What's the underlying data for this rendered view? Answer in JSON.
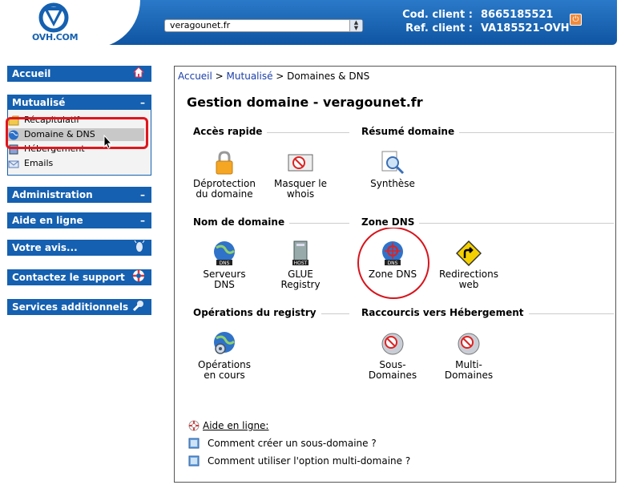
{
  "header": {
    "logo_text": "OVH.COM",
    "domain_select": "veragounet.fr",
    "client_code_label": "Cod. client :",
    "client_code": "8665185521",
    "client_ref_label": "Ref. client :",
    "client_ref": "VA185521-OVH",
    "brand_color": "#1560b0"
  },
  "sidebar": {
    "accueil": "Accueil",
    "mutualise": "Mutualisé",
    "mutualise_items": [
      "Récapitulatif",
      "Domaine & DNS",
      "Hébergement",
      "Emails"
    ],
    "administration": "Administration",
    "aide": "Aide en ligne",
    "avis": "Votre avis...",
    "support": "Contactez le support",
    "services": "Services additionnels",
    "collapse_symbol": "–"
  },
  "breadcrumb": {
    "home": "Accueil",
    "sep1": " > ",
    "mutualise": "Mutualisé",
    "sep2": " > ",
    "current": "Domaines & DNS"
  },
  "page_title": "Gestion domaine - veragounet.fr",
  "sections": {
    "acces_rapide": "Accès rapide",
    "resume": "Résumé domaine",
    "nom_domaine": "Nom de domaine",
    "zone_dns": "Zone DNS",
    "operations": "Opérations du registry",
    "raccourcis": "Raccourcis vers Hébergement"
  },
  "tiles": {
    "deprotection": [
      "Déprotection",
      "du domaine"
    ],
    "masquer": [
      "Masquer le",
      "whois"
    ],
    "synthese": [
      "Synthèse"
    ],
    "serveurs": [
      "Serveurs",
      "DNS"
    ],
    "glue": [
      "GLUE",
      "Registry"
    ],
    "zone": [
      "Zone DNS"
    ],
    "redirections": [
      "Redirections",
      "web"
    ],
    "operations": [
      "Opérations",
      "en cours"
    ],
    "sous": [
      "Sous-",
      "Domaines"
    ],
    "multi": [
      "Multi-",
      "Domaines"
    ]
  },
  "icon_labels": {
    "dns": "DNS",
    "host": "HOST"
  },
  "help": {
    "title": "Aide en ligne:",
    "q1": "Comment créer un sous-domaine ?",
    "q2": "Comment utiliser l'option multi-domaine ?"
  }
}
